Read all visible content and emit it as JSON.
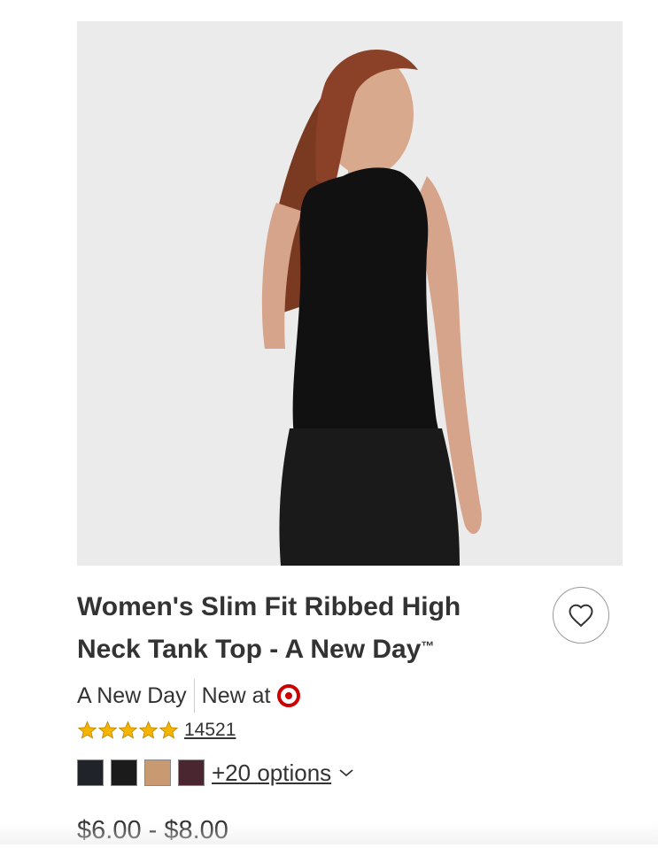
{
  "product": {
    "title": "Women's Slim Fit Ribbed High Neck Tank Top - A New Day",
    "trademark": "™",
    "brand": "A New Day",
    "new_at_label": "New at",
    "rating": 5,
    "rating_max": 5,
    "review_count": "14521",
    "swatches": [
      {
        "name": "navy",
        "color": "#20232a"
      },
      {
        "name": "black",
        "color": "#1b1b1b"
      },
      {
        "name": "tan",
        "color": "#c99a72"
      },
      {
        "name": "burgundy",
        "color": "#4a2630"
      }
    ],
    "more_options": "+20 options",
    "price": "$6.00 - $8.00"
  },
  "colors": {
    "text": "#333333",
    "star": "#f5b400",
    "target_red": "#cc0000",
    "image_bg": "#ebebeb"
  },
  "icons": {
    "favorite": "heart-icon",
    "retailer": "target-logo-icon",
    "options_expand": "chevron-down-icon"
  }
}
